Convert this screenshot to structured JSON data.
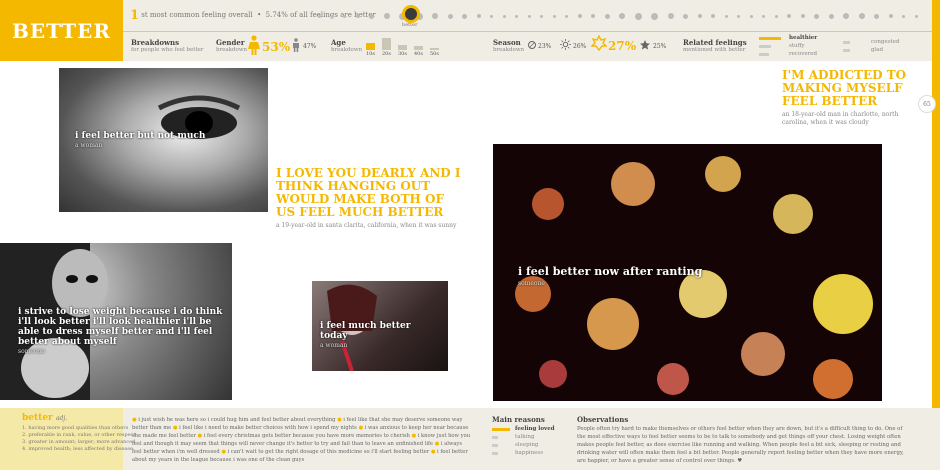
{
  "header": {
    "title": "BETTER",
    "rank_num": "1",
    "rank_text": "st most common feeling overall",
    "share_text": "5.74% of all feelings are better",
    "selected_label": "better"
  },
  "breakdowns": {
    "title": "Breakdowns",
    "subtitle": "for people who feel better",
    "gender": {
      "label": "Gender",
      "sub": "breakdown",
      "female_pct": "53%",
      "male_pct": "47%"
    },
    "age": {
      "label": "Age",
      "sub": "breakdown",
      "groups": [
        {
          "label": "10s",
          "value": 0.55
        },
        {
          "label": "20s",
          "value": 1.0
        },
        {
          "label": "30s",
          "value": 0.42
        },
        {
          "label": "40s",
          "value": 0.3
        },
        {
          "label": "50s",
          "value": 0.2
        }
      ]
    },
    "season": {
      "label": "Season",
      "sub": "breakdown",
      "winter": "23%",
      "summer": "26%",
      "spring": "27%",
      "fall": "25%"
    },
    "related": {
      "title": "Related feelings",
      "subtitle": "mentioned with better",
      "col1": [
        "healthier",
        "stuffy",
        "recovered"
      ],
      "col2": [
        "congested",
        "glad"
      ]
    }
  },
  "page_number": "65",
  "photos": [
    {
      "caption": "i feel better but not much",
      "author": "a woman"
    },
    {
      "caption": "i strive to lose weight because i do think i'll look better i'll look healthier i'll be able to dress myself better and i'll feel better about myself",
      "author": "someone"
    },
    {
      "caption": "i feel much better today",
      "author": "a woman"
    },
    {
      "caption": "i feel better now after ranting",
      "author": "someone"
    }
  ],
  "quotes": [
    {
      "text": "i'm addicted to making myself feel better",
      "author": "an 18-year-old man in charlotte, north carolina, when it was cloudy"
    },
    {
      "text": "i love you dearly and i think hanging out would make both of us feel much better",
      "author": "a 19-year-old in santa clarita, california, when it was sunny"
    }
  ],
  "definition": {
    "word": "better",
    "pos": "adj.",
    "items": [
      "1. having more good qualities than others",
      "2. preferable in rank, value, or other respect",
      "3. greater in amount; larger; more advanced",
      "4. improved health; less affected by disease"
    ]
  },
  "snippets": [
    "i just wish he was here so i could hug him and feel better about everything",
    "i feel like that she may deserve someone way better than me",
    "i feel like i need to make better choices with how i spend my nights",
    "i was anxious to keep her near because she made me feel better",
    "i feel every christmas gets better because you have more memories to cherish",
    "i know just how you feel and though it may seem that things will never change it's better to try and fail than to leave an unfinished life",
    "i always feel better when i'm well dressed",
    "i can't wait to get the right dosage of this medicine so i'll start feeling better",
    "i feel better about my years in the league because i was one of the clean guys"
  ],
  "reasons": {
    "title": "Main reasons",
    "items": [
      "feeling loved",
      "talking",
      "sleeping",
      "happiness"
    ]
  },
  "observations": {
    "title": "Observations",
    "text": "People often try hard to make themselves or others feel better when they are down, but it's a difficult thing to do. One of the most effective ways to feel better seems to be to talk to somebody and get things off your chest. Losing weight often makes people feel better, as does exercise like running and walking. When people feel a bit sick, sleeping or resting and drinking water will often make them feel a bit better. People generally report feeling better when they have more energy, are happier, or have a greater sense of control over things. ♥"
  },
  "colors": {
    "accent": "#f5b800",
    "strip": "#efede4"
  }
}
